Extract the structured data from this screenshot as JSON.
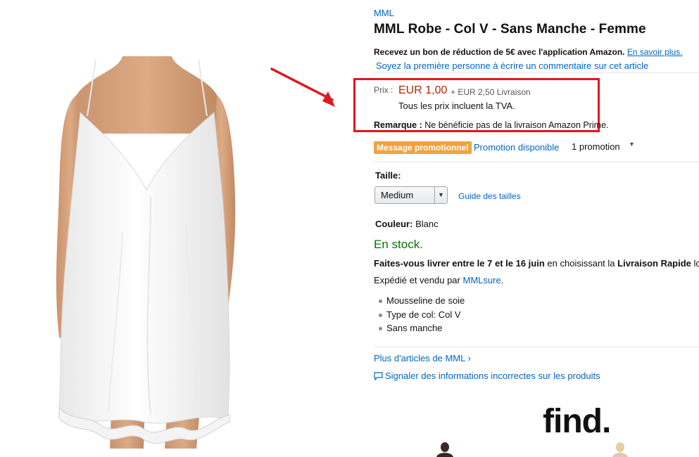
{
  "product": {
    "brand": "MML",
    "title": "MML Robe - Col V - Sans Manche - Femme"
  },
  "coupon": {
    "text": "Recevez un bon de réduction de 5€ avec l'application Amazon.",
    "link": "En savoir plus."
  },
  "reviews": {
    "link": "Soyez la première personne à écrire un commentaire sur cet article"
  },
  "price": {
    "label": "Prix :",
    "value": "EUR 1,00",
    "shipping": "+ EUR 2,50 Livraison",
    "vat": "Tous les prix incluent la TVA."
  },
  "remark": {
    "label": "Remarque :",
    "text": "Ne bénéficie pas de la livraison Amazon Prime."
  },
  "promotion": {
    "badge": "Message promotionnel",
    "link": "Promotion disponible",
    "count": "1 promotion"
  },
  "size": {
    "label": "Taille:",
    "selected": "Medium",
    "guide": "Guide des tailles"
  },
  "color": {
    "label": "Couleur:",
    "value": "Blanc"
  },
  "stock": "En stock.",
  "delivery": {
    "prefix": "Faites-vous livrer entre le 7 et le 16 juin",
    "middle": "en choisissant la",
    "option": "Livraison Rapide",
    "suffix": "lo"
  },
  "seller": {
    "prefix": "Expédié et vendu par",
    "name": "MMLsure",
    "suffix": "."
  },
  "bullets": [
    "Mousseline de soie",
    "Type de col: Col V",
    "Sans manche"
  ],
  "links": {
    "more_articles": "Plus d'articles de MML ›",
    "report": "Signaler des informations incorrectes sur les produits"
  },
  "ad": {
    "logo": "find."
  },
  "colors": {
    "link": "#0066c0",
    "price": "#b12704",
    "stock": "#007600",
    "badge": "#f0a340",
    "highlight": "#e0171b"
  },
  "icons": {
    "promo_caret": "caret-down-icon",
    "select_arrow": "chevron-down-icon",
    "report": "comment-icon"
  }
}
